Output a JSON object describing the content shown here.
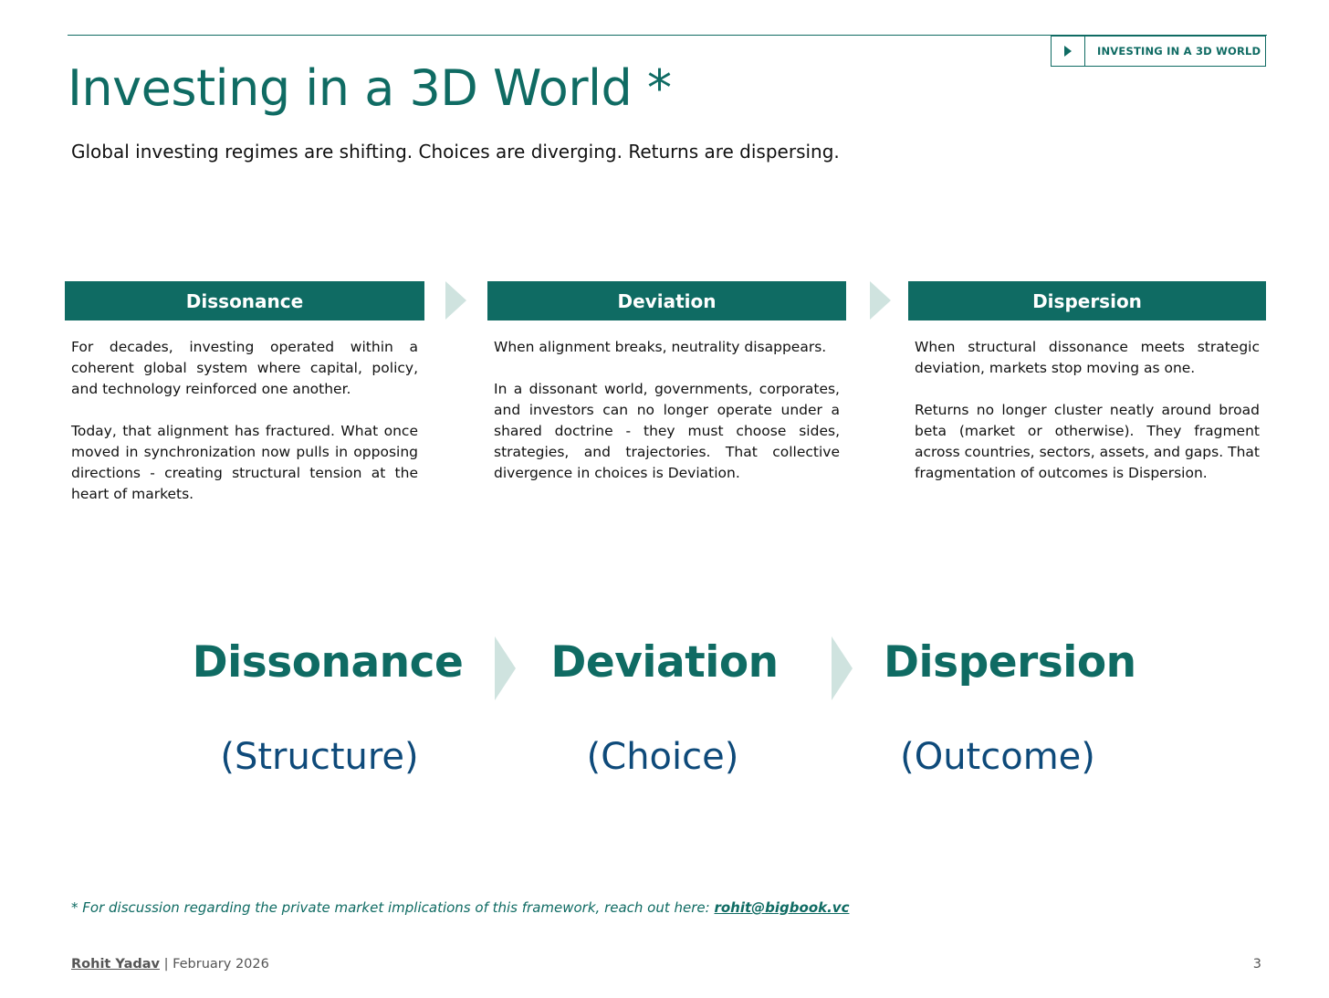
{
  "header": {
    "section_tag": "INVESTING IN A 3D WORLD",
    "tag_icon": "play-triangle-icon"
  },
  "title": "Investing in a 3D World *",
  "subtitle": "Global investing regimes are shifting. Choices are diverging. Returns are dispersing.",
  "columns": [
    {
      "heading": "Dissonance",
      "paragraphs": [
        "For decades, investing operated within a coherent global system where capital, policy, and technology reinforced one another.",
        "Today, that alignment has fractured. What once moved in synchronization now pulls in opposing directions - creating structural tension at the heart of markets."
      ]
    },
    {
      "heading": "Deviation",
      "paragraphs": [
        "When alignment breaks, neutrality disappears.",
        "In a dissonant world, governments, corporates, and investors can no longer operate under a shared doctrine - they must choose sides, strategies, and trajectories. That collective divergence in choices is Deviation."
      ]
    },
    {
      "heading": "Dispersion",
      "paragraphs": [
        "When structural dissonance meets strategic deviation, markets stop moving as one.",
        "Returns no longer cluster neatly around broad beta (market or otherwise). They fragment across countries, sectors, assets, and gaps. That fragmentation of outcomes is Dispersion."
      ]
    }
  ],
  "framework": [
    {
      "word": "Dissonance",
      "label": "(Structure)"
    },
    {
      "word": "Deviation",
      "label": "(Choice)"
    },
    {
      "word": "Dispersion",
      "label": "(Outcome)"
    }
  ],
  "footnote": {
    "text": "* For discussion regarding the private market implications of this framework, reach out here: ",
    "email": "rohit@bigbook.vc"
  },
  "footer": {
    "author": "Rohit Yadav",
    "separator": " | ",
    "date": "February 2026",
    "page_number": "3"
  },
  "colors": {
    "primary": "#0f6b63",
    "chevron": "#cfe3df",
    "secondary": "#0e4a7a"
  }
}
